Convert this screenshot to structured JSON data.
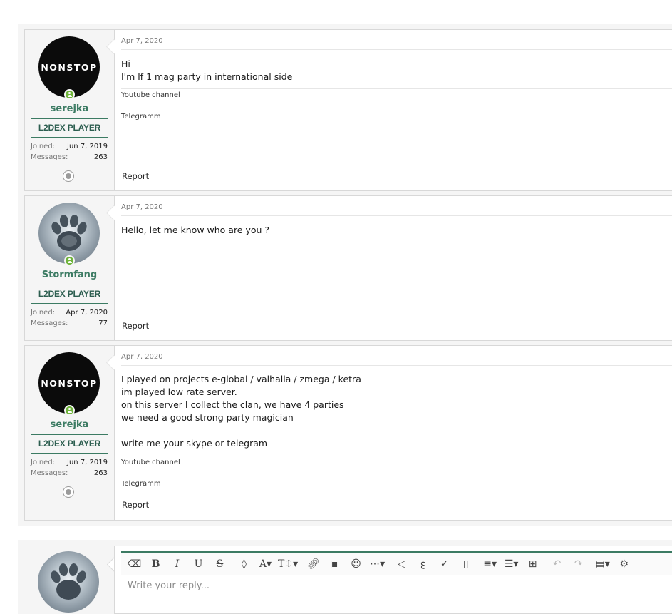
{
  "posts": [
    {
      "date": "Apr 7, 2020",
      "user": {
        "name": "serejka",
        "title": "L2DEX PLAYER",
        "avatar": "NONSTOP",
        "joined_label": "Joined:",
        "joined": "Jun 7, 2019",
        "messages_label": "Messages:",
        "messages": "263"
      },
      "body": [
        "Hi",
        "I'm lf 1 mag party in international side"
      ],
      "signature": [
        "Youtube channel",
        "Telegramm"
      ],
      "report": "Report"
    },
    {
      "date": "Apr 7, 2020",
      "user": {
        "name": "Stormfang",
        "title": "L2DEX PLAYER",
        "avatar": "wolf-paw",
        "joined_label": "Joined:",
        "joined": "Apr 7, 2020",
        "messages_label": "Messages:",
        "messages": "77"
      },
      "body": [
        "Hello, let me know who are you ?"
      ],
      "report": "Report"
    },
    {
      "date": "Apr 7, 2020",
      "user": {
        "name": "serejka",
        "title": "L2DEX PLAYER",
        "avatar": "NONSTOP",
        "joined_label": "Joined:",
        "joined": "Jun 7, 2019",
        "messages_label": "Messages:",
        "messages": "263"
      },
      "body": [
        "I played on projects e-global / valhalla / zmega / ketra",
        "im played low rate server.",
        "on this server I collect the clan, we have 4 parties",
        "we need a good strong party magician",
        "",
        "write me your skype or telegram"
      ],
      "signature": [
        "Youtube channel",
        "Telegramm"
      ],
      "report": "Report"
    }
  ],
  "editor": {
    "placeholder": "Write your reply...",
    "toolbar": [
      "eraser-icon",
      "bold-icon",
      "italic-icon",
      "underline-icon",
      "strikethrough-icon",
      "text-color-icon",
      "font-size-icon",
      "text-style-icon",
      "link-icon",
      "image-icon",
      "smilie-icon",
      "more-icon",
      "spoiler-icon",
      "code-icon",
      "check-icon",
      "inline-code-icon",
      "align-icon",
      "list-icon",
      "table-icon",
      "undo-icon",
      "redo-icon",
      "drafts-icon",
      "settings-icon"
    ]
  },
  "colors": {
    "accent": "#3c7b63",
    "online": "#6fb43b"
  }
}
